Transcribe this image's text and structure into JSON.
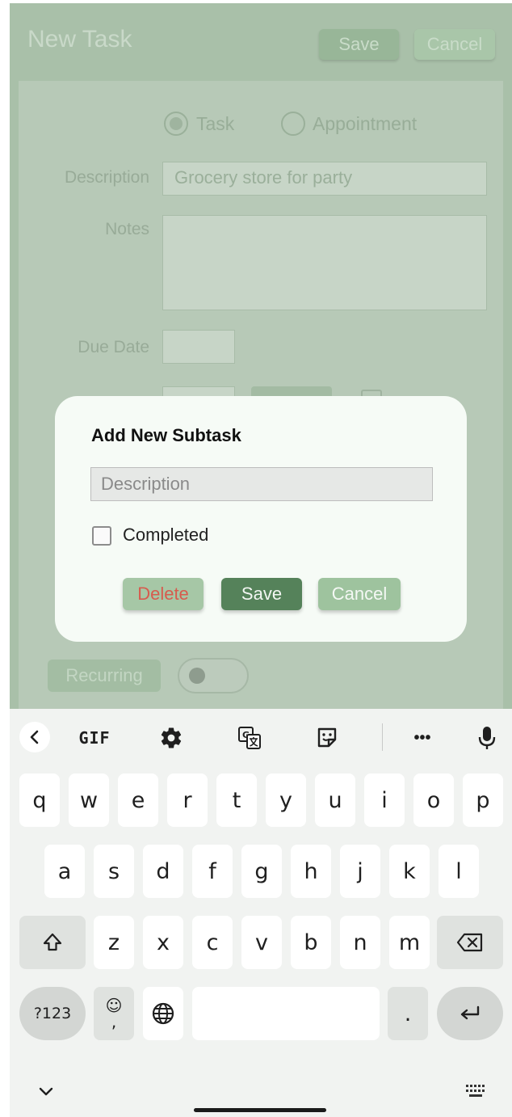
{
  "app": {
    "title": "New Task",
    "save_label": "Save",
    "cancel_label": "Cancel",
    "type_task_label": "Task",
    "type_appointment_label": "Appointment",
    "description_label": "Description",
    "description_value": "Grocery store for party",
    "notes_label": "Notes",
    "due_date_label": "Due Date",
    "recurring_label": "Recurring"
  },
  "dialog": {
    "title": "Add New Subtask",
    "description_placeholder": "Description",
    "completed_label": "Completed",
    "delete_label": "Delete",
    "save_label": "Save",
    "cancel_label": "Cancel"
  },
  "keyboard": {
    "toolbar": {
      "gif_label": "GIF",
      "more_label": "•••"
    },
    "row1": [
      "q",
      "w",
      "e",
      "r",
      "t",
      "y",
      "u",
      "i",
      "o",
      "p"
    ],
    "row2": [
      "a",
      "s",
      "d",
      "f",
      "g",
      "h",
      "j",
      "k",
      "l"
    ],
    "row3": [
      "z",
      "x",
      "c",
      "v",
      "b",
      "n",
      "m"
    ],
    "symbols_label": "?123",
    "emoji_label": "☺",
    "comma_label": ",",
    "period_label": "."
  },
  "colors": {
    "accent": "#55825a",
    "delete_text": "#d75b4e",
    "dim_overlay": "#a9c0a9"
  }
}
